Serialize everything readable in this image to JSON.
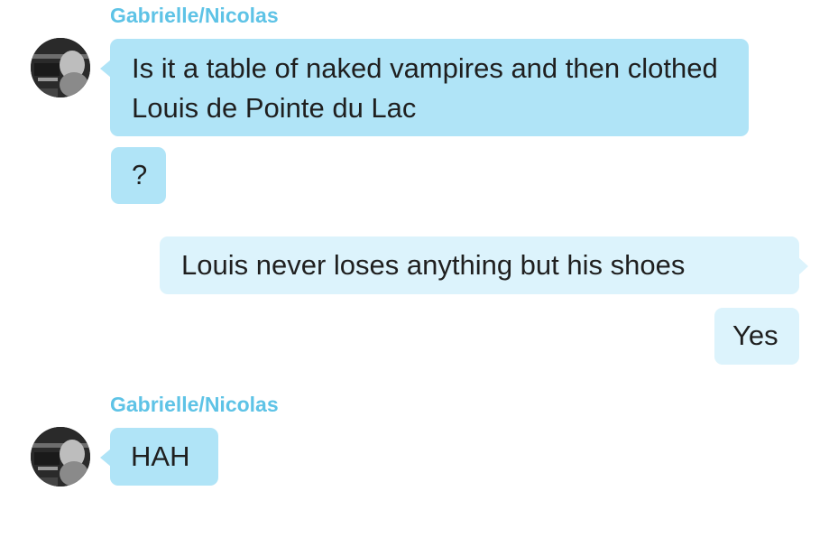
{
  "conversation": {
    "groups": [
      {
        "sender": "Gabrielle/Nicolas",
        "avatar_icon": "profile-photo",
        "messages": [
          "Is it a table of naked vampires and then clothed Louis de Pointe du Lac",
          "?"
        ]
      },
      {
        "sender": "self",
        "messages": [
          "Louis never loses anything but his shoes",
          "Yes"
        ]
      },
      {
        "sender": "Gabrielle/Nicolas",
        "avatar_icon": "profile-photo",
        "messages": [
          "HAH"
        ]
      }
    ]
  },
  "colors": {
    "sender_name": "#5ec3e6",
    "incoming_bubble": "#b0e4f7",
    "outgoing_bubble": "#dcf3fc",
    "text": "#1f1f1f"
  }
}
